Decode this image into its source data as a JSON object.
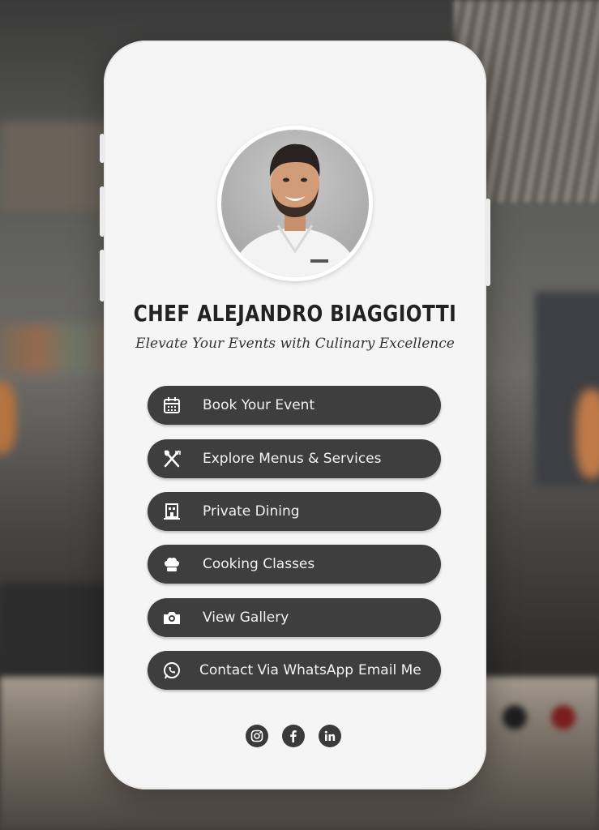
{
  "profile": {
    "name": "CHEF ALEJANDRO BIAGGIOTTI",
    "tagline": "Elevate Your Events with Culinary Excellence",
    "photo_icon": "chef-portrait"
  },
  "buttons": [
    {
      "label": "Book Your Event",
      "icon": "calendar-icon"
    },
    {
      "label": "Explore Menus & Services",
      "icon": "utensils-icon"
    },
    {
      "label": "Private Dining",
      "icon": "restaurant-building-icon"
    },
    {
      "label": "Cooking Classes",
      "icon": "chef-hat-icon"
    },
    {
      "label": "View Gallery",
      "icon": "camera-icon"
    },
    {
      "label": "Contact Via WhatsApp",
      "label2": "Email Me",
      "icon": "whatsapp-icon"
    }
  ],
  "social": [
    {
      "name": "instagram",
      "icon": "instagram-icon"
    },
    {
      "name": "facebook",
      "icon": "facebook-icon"
    },
    {
      "name": "linkedin",
      "icon": "linkedin-icon"
    }
  ],
  "colors": {
    "button_bg": "#3e3e3e",
    "card_bg": "#f5f5f5",
    "text_dark": "#222222"
  }
}
